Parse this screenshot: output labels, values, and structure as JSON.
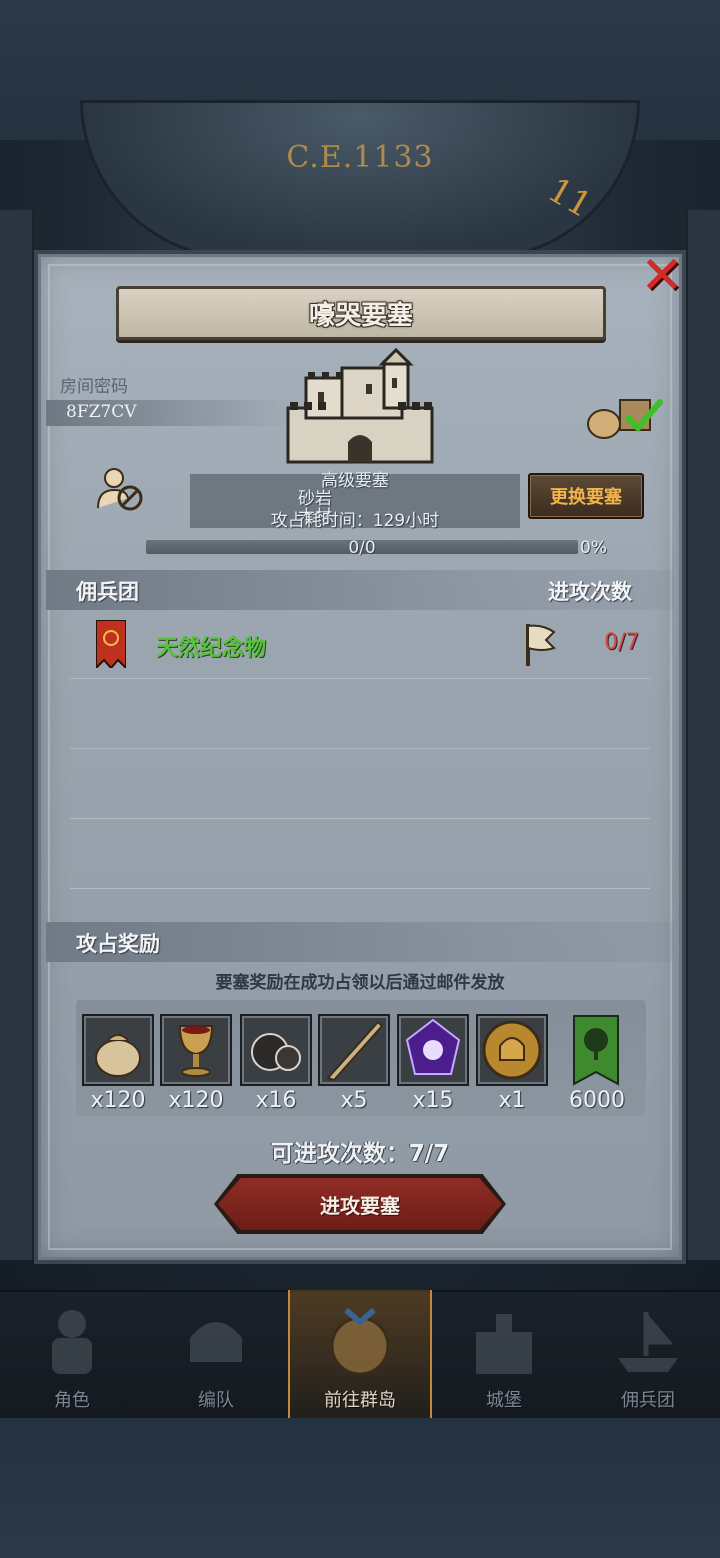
{
  "era": {
    "label": "C.E.1133",
    "dial_number": "11"
  },
  "dialog": {
    "title": "嚎哭要塞",
    "room": {
      "label": "房间密码",
      "code": "8FZ7CV"
    },
    "fortress_info": {
      "line1": "高级要塞",
      "line2": "砂岩",
      "line3": "木材",
      "line4": "攻占耗时间：129小时",
      "line4_value": "129"
    },
    "change_button": "更换要塞",
    "progress": {
      "text": "0/0",
      "percent_label": "0%",
      "fraction": 0
    },
    "mercenary": {
      "section_title": "佣兵团",
      "attacks_header": "进攻次数",
      "rows": [
        {
          "name": "天然纪念物",
          "attacks": "0/7"
        }
      ]
    },
    "rewards": {
      "section_title": "攻占奖励",
      "note": "要塞奖励在成功占领以后通过邮件发放",
      "items": [
        {
          "icon": "sack-icon",
          "qty": "x120"
        },
        {
          "icon": "goblet-icon",
          "qty": "x120"
        },
        {
          "icon": "ore-icon",
          "qty": "x16"
        },
        {
          "icon": "horn-icon",
          "qty": "x5"
        },
        {
          "icon": "crystal-icon",
          "qty": "x15"
        },
        {
          "icon": "helmet-medal-icon",
          "qty": "x1"
        },
        {
          "icon": "tree-banner-icon",
          "qty": "6000"
        }
      ]
    },
    "attack_count": "可进攻次数：7/7",
    "attack_button": "进攻要塞"
  },
  "bottom_nav": [
    {
      "label": "角色",
      "icon": "knight-icon",
      "active": false
    },
    {
      "label": "编队",
      "icon": "helmet-icon",
      "active": false
    },
    {
      "label": "前往群岛",
      "icon": "map-compass-icon",
      "active": true
    },
    {
      "label": "城堡",
      "icon": "castle-icon",
      "active": false
    },
    {
      "label": "佣兵团",
      "icon": "ship-icon",
      "active": false
    }
  ],
  "colors": {
    "panel": "#9aa5af",
    "accent_gold": "#f1b34a",
    "merc_green": "#57c43e",
    "count_red": "#d24b44",
    "attack_button": "#7d2520"
  }
}
